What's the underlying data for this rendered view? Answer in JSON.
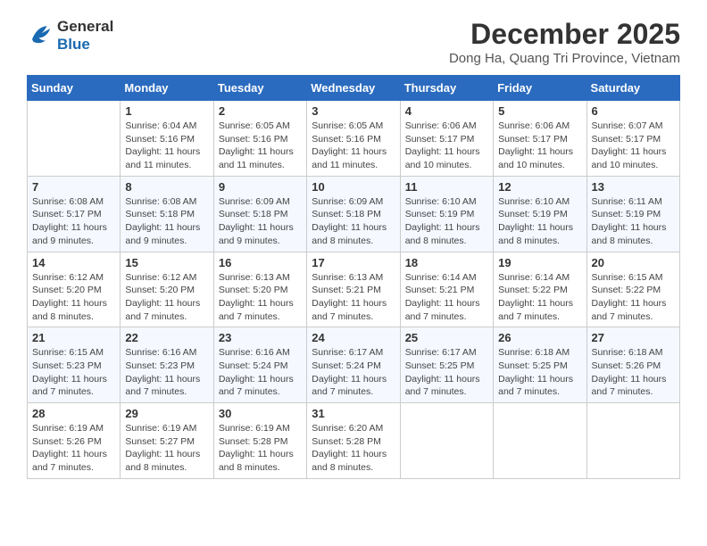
{
  "header": {
    "logo_line1": "General",
    "logo_line2": "Blue",
    "title": "December 2025",
    "subtitle": "Dong Ha, Quang Tri Province, Vietnam"
  },
  "days_of_week": [
    "Sunday",
    "Monday",
    "Tuesday",
    "Wednesday",
    "Thursday",
    "Friday",
    "Saturday"
  ],
  "weeks": [
    [
      {
        "day": "",
        "info": ""
      },
      {
        "day": "1",
        "info": "Sunrise: 6:04 AM\nSunset: 5:16 PM\nDaylight: 11 hours and 11 minutes."
      },
      {
        "day": "2",
        "info": "Sunrise: 6:05 AM\nSunset: 5:16 PM\nDaylight: 11 hours and 11 minutes."
      },
      {
        "day": "3",
        "info": "Sunrise: 6:05 AM\nSunset: 5:16 PM\nDaylight: 11 hours and 11 minutes."
      },
      {
        "day": "4",
        "info": "Sunrise: 6:06 AM\nSunset: 5:17 PM\nDaylight: 11 hours and 10 minutes."
      },
      {
        "day": "5",
        "info": "Sunrise: 6:06 AM\nSunset: 5:17 PM\nDaylight: 11 hours and 10 minutes."
      },
      {
        "day": "6",
        "info": "Sunrise: 6:07 AM\nSunset: 5:17 PM\nDaylight: 11 hours and 10 minutes."
      }
    ],
    [
      {
        "day": "7",
        "info": "Sunrise: 6:08 AM\nSunset: 5:17 PM\nDaylight: 11 hours and 9 minutes."
      },
      {
        "day": "8",
        "info": "Sunrise: 6:08 AM\nSunset: 5:18 PM\nDaylight: 11 hours and 9 minutes."
      },
      {
        "day": "9",
        "info": "Sunrise: 6:09 AM\nSunset: 5:18 PM\nDaylight: 11 hours and 9 minutes."
      },
      {
        "day": "10",
        "info": "Sunrise: 6:09 AM\nSunset: 5:18 PM\nDaylight: 11 hours and 8 minutes."
      },
      {
        "day": "11",
        "info": "Sunrise: 6:10 AM\nSunset: 5:19 PM\nDaylight: 11 hours and 8 minutes."
      },
      {
        "day": "12",
        "info": "Sunrise: 6:10 AM\nSunset: 5:19 PM\nDaylight: 11 hours and 8 minutes."
      },
      {
        "day": "13",
        "info": "Sunrise: 6:11 AM\nSunset: 5:19 PM\nDaylight: 11 hours and 8 minutes."
      }
    ],
    [
      {
        "day": "14",
        "info": "Sunrise: 6:12 AM\nSunset: 5:20 PM\nDaylight: 11 hours and 8 minutes."
      },
      {
        "day": "15",
        "info": "Sunrise: 6:12 AM\nSunset: 5:20 PM\nDaylight: 11 hours and 7 minutes."
      },
      {
        "day": "16",
        "info": "Sunrise: 6:13 AM\nSunset: 5:20 PM\nDaylight: 11 hours and 7 minutes."
      },
      {
        "day": "17",
        "info": "Sunrise: 6:13 AM\nSunset: 5:21 PM\nDaylight: 11 hours and 7 minutes."
      },
      {
        "day": "18",
        "info": "Sunrise: 6:14 AM\nSunset: 5:21 PM\nDaylight: 11 hours and 7 minutes."
      },
      {
        "day": "19",
        "info": "Sunrise: 6:14 AM\nSunset: 5:22 PM\nDaylight: 11 hours and 7 minutes."
      },
      {
        "day": "20",
        "info": "Sunrise: 6:15 AM\nSunset: 5:22 PM\nDaylight: 11 hours and 7 minutes."
      }
    ],
    [
      {
        "day": "21",
        "info": "Sunrise: 6:15 AM\nSunset: 5:23 PM\nDaylight: 11 hours and 7 minutes."
      },
      {
        "day": "22",
        "info": "Sunrise: 6:16 AM\nSunset: 5:23 PM\nDaylight: 11 hours and 7 minutes."
      },
      {
        "day": "23",
        "info": "Sunrise: 6:16 AM\nSunset: 5:24 PM\nDaylight: 11 hours and 7 minutes."
      },
      {
        "day": "24",
        "info": "Sunrise: 6:17 AM\nSunset: 5:24 PM\nDaylight: 11 hours and 7 minutes."
      },
      {
        "day": "25",
        "info": "Sunrise: 6:17 AM\nSunset: 5:25 PM\nDaylight: 11 hours and 7 minutes."
      },
      {
        "day": "26",
        "info": "Sunrise: 6:18 AM\nSunset: 5:25 PM\nDaylight: 11 hours and 7 minutes."
      },
      {
        "day": "27",
        "info": "Sunrise: 6:18 AM\nSunset: 5:26 PM\nDaylight: 11 hours and 7 minutes."
      }
    ],
    [
      {
        "day": "28",
        "info": "Sunrise: 6:19 AM\nSunset: 5:26 PM\nDaylight: 11 hours and 7 minutes."
      },
      {
        "day": "29",
        "info": "Sunrise: 6:19 AM\nSunset: 5:27 PM\nDaylight: 11 hours and 8 minutes."
      },
      {
        "day": "30",
        "info": "Sunrise: 6:19 AM\nSunset: 5:28 PM\nDaylight: 11 hours and 8 minutes."
      },
      {
        "day": "31",
        "info": "Sunrise: 6:20 AM\nSunset: 5:28 PM\nDaylight: 11 hours and 8 minutes."
      },
      {
        "day": "",
        "info": ""
      },
      {
        "day": "",
        "info": ""
      },
      {
        "day": "",
        "info": ""
      }
    ]
  ]
}
